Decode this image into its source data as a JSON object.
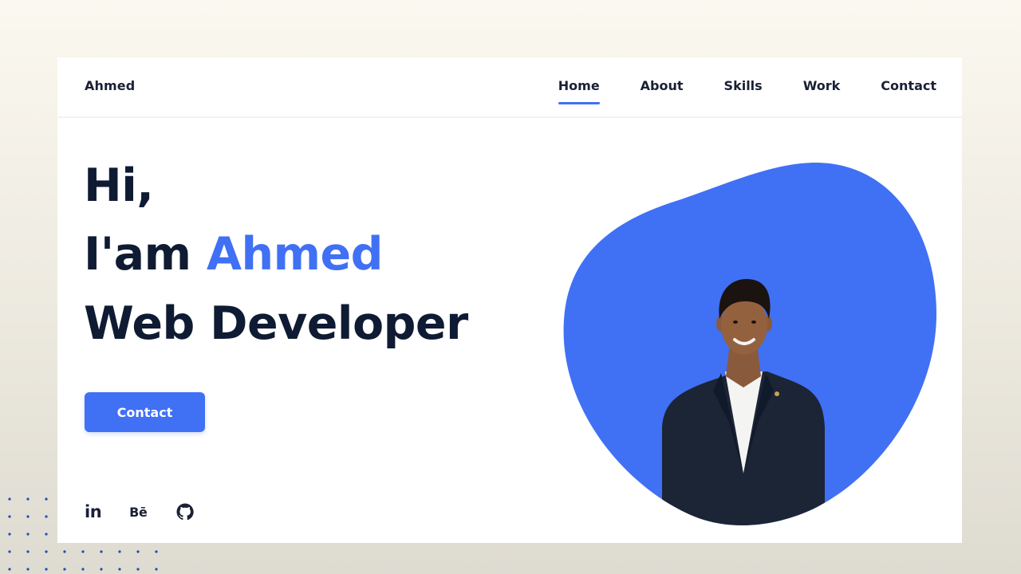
{
  "brand": {
    "logo_text": "Ahmed",
    "accent_color": "#4070f4",
    "text_color": "#0f1b33"
  },
  "nav": {
    "items": [
      {
        "label": "Home",
        "active": true
      },
      {
        "label": "About",
        "active": false
      },
      {
        "label": "Skills",
        "active": false
      },
      {
        "label": "Work",
        "active": false
      },
      {
        "label": "Contact",
        "active": false
      }
    ]
  },
  "hero": {
    "greeting": "Hi,",
    "intro_prefix": "I'am ",
    "name": "Ahmed",
    "role": "Web Developer",
    "cta_label": "Contact"
  },
  "socials": [
    {
      "icon": "linkedin-icon",
      "glyph": "in"
    },
    {
      "icon": "behance-icon",
      "glyph": "Bē"
    },
    {
      "icon": "github-icon",
      "glyph": ""
    }
  ],
  "portrait": {
    "blob_color": "#4070f4",
    "description": "person-portrait"
  }
}
